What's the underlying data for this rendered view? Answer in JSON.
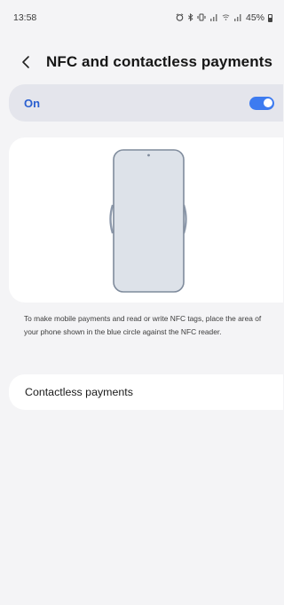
{
  "status_bar": {
    "time": "13:58",
    "battery_percent": "45%",
    "icons": [
      "alarm-icon",
      "bluetooth-icon",
      "vibrate-icon",
      "wifi-icon",
      "signal-icon"
    ]
  },
  "header": {
    "title": "NFC and contactless payments"
  },
  "toggle": {
    "label": "On",
    "state": true,
    "accent_color": "#3d7bf0"
  },
  "description": "To make mobile payments and read or write NFC tags, place the area of your phone shown in the blue circle against the NFC reader.",
  "menu": {
    "contactless_payments_label": "Contactless payments"
  }
}
